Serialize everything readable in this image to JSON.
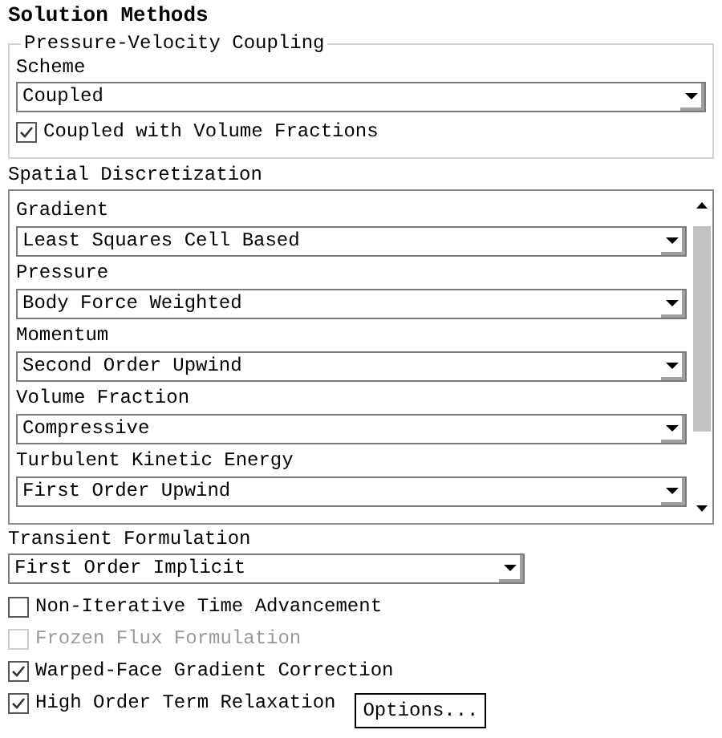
{
  "title": "Solution Methods",
  "pressure_velocity_coupling": {
    "legend": "Pressure-Velocity Coupling",
    "scheme": {
      "label": "Scheme",
      "value": "Coupled"
    },
    "option": {
      "label": "Coupled with Volume Fractions",
      "checked": true
    }
  },
  "spatial_discretization": {
    "label": "Spatial Discretization",
    "items": [
      {
        "label": "Gradient",
        "value": "Least Squares Cell Based"
      },
      {
        "label": "Pressure",
        "value": "Body Force Weighted"
      },
      {
        "label": "Momentum",
        "value": "Second Order Upwind"
      },
      {
        "label": "Volume Fraction",
        "value": "Compressive"
      },
      {
        "label": "Turbulent Kinetic Energy",
        "value": "First Order Upwind"
      }
    ]
  },
  "transient_formulation": {
    "label": "Transient Formulation",
    "value": "First Order Implicit"
  },
  "options": [
    {
      "label": "Non-Iterative Time Advancement",
      "checked": false,
      "disabled": false
    },
    {
      "label": "Frozen Flux Formulation",
      "checked": false,
      "disabled": true
    },
    {
      "label": "Warped-Face Gradient Correction",
      "checked": true,
      "disabled": false
    },
    {
      "label": "High Order Term Relaxation",
      "checked": true,
      "disabled": false,
      "button": "Options..."
    }
  ]
}
